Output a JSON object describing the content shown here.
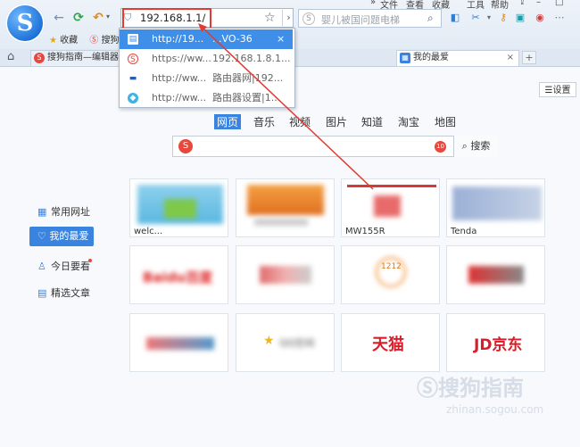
{
  "colors": {
    "accent": "#3a84e0",
    "highlight": "#e23b2f",
    "dropdown_selected": "#3f8ee8"
  },
  "toolbar": {
    "logo_glyph": "S",
    "menu_items": [
      "文件",
      "查看",
      "收藏",
      "工具",
      "帮助"
    ],
    "address_value": "192.168.1.1/",
    "search_placeholder": "婴儿被国问题电梯"
  },
  "bookmarks": {
    "fav_label": "收藏",
    "sogou_label": "搜狗"
  },
  "tabs": [
    {
      "label": "搜狗指南—编辑器",
      "active": false
    },
    {
      "label": "我的最爱",
      "active": true
    }
  ],
  "dropdown": [
    {
      "url": "http://19...",
      "title": "...VO-36",
      "selected": true,
      "icon": "page-icon"
    },
    {
      "url": "https://ww...",
      "title": "192.168.1.8.1...",
      "selected": false,
      "icon": "sogou-icon"
    },
    {
      "url": "http://ww...",
      "title": "路由器网|192...",
      "selected": false,
      "icon": "router-icon"
    },
    {
      "url": "http://ww...",
      "title": "路由器设置|1...",
      "selected": false,
      "icon": "bird-icon"
    }
  ],
  "page": {
    "settings_label": "设置",
    "categories": [
      {
        "label": "网页",
        "selected": true
      },
      {
        "label": "音乐",
        "selected": false
      },
      {
        "label": "视频",
        "selected": false
      },
      {
        "label": "图片",
        "selected": false
      },
      {
        "label": "知道",
        "selected": false
      },
      {
        "label": "淘宝",
        "selected": false
      },
      {
        "label": "地图",
        "selected": false
      }
    ],
    "search_button": "搜索",
    "search_badge": "10",
    "sidebar": [
      {
        "label": "常用网址",
        "icon": "grid-icon",
        "active": false
      },
      {
        "label": "我的最爱",
        "icon": "heart-icon",
        "active": true
      },
      {
        "label": "今日要看",
        "icon": "person-icon",
        "active": false
      },
      {
        "label": "精选文章",
        "icon": "doc-icon",
        "active": false
      }
    ],
    "tiles": [
      {
        "label": "welc...",
        "logo": ""
      },
      {
        "label": "",
        "logo": ""
      },
      {
        "label": "MW155R",
        "logo": ""
      },
      {
        "label": "Tenda",
        "logo": ""
      },
      {
        "label": "",
        "logo": "Baidu百度"
      },
      {
        "label": "",
        "logo": ""
      },
      {
        "label": "",
        "logo": "1212"
      },
      {
        "label": "",
        "logo": ""
      },
      {
        "label": "",
        "logo": ""
      },
      {
        "label": "",
        "logo": "QQ空间"
      },
      {
        "label": "",
        "logo": "天猫"
      },
      {
        "label": "",
        "logo": "JD京东"
      }
    ]
  },
  "watermark": {
    "text": "搜狗指南",
    "url": "zhinan.sogou.com"
  }
}
